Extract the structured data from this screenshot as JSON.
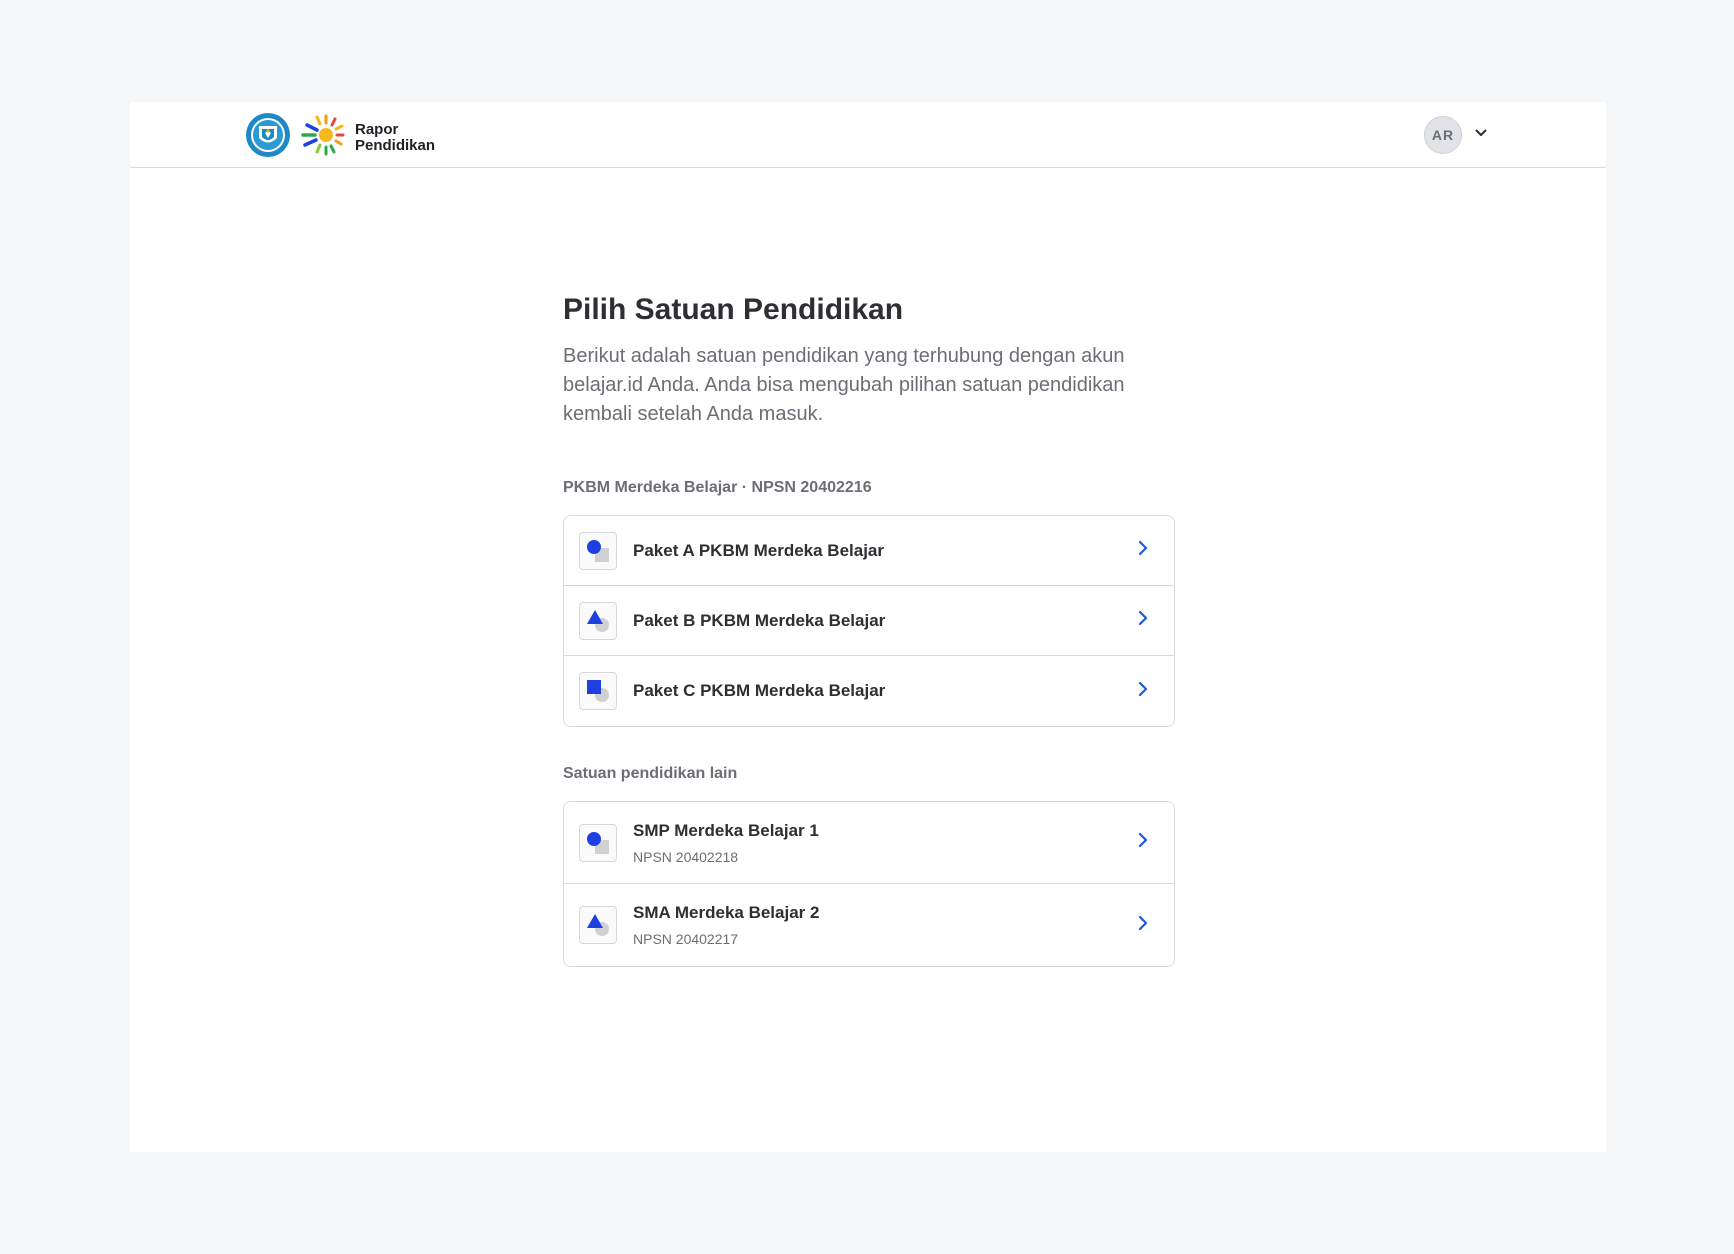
{
  "header": {
    "brand_line1": "Rapor",
    "brand_line2": "Pendidikan",
    "user_initials": "AR"
  },
  "main": {
    "title": "Pilih Satuan Pendidikan",
    "intro": "Berikut adalah satuan pendidikan yang terhubung dengan akun belajar.id Anda. Anda bisa mengubah pilihan satuan pendidikan kembali setelah Anda masuk."
  },
  "group_pkbm": {
    "label": "PKBM Merdeka Belajar · NPSN 20402216",
    "items": [
      {
        "title": "Paket A PKBM Merdeka Belajar",
        "icon": "circle-square-icon"
      },
      {
        "title": "Paket B PKBM Merdeka Belajar",
        "icon": "triangle-circle-icon"
      },
      {
        "title": "Paket C PKBM Merdeka Belajar",
        "icon": "square-circle-icon"
      }
    ]
  },
  "group_other": {
    "label": "Satuan pendidikan lain",
    "items": [
      {
        "title": "SMP Merdeka Belajar 1",
        "subtitle": "NPSN 20402218",
        "icon": "circle-square-icon"
      },
      {
        "title": "SMA Merdeka Belajar 2",
        "subtitle": "NPSN 20402217",
        "icon": "triangle-circle-icon"
      }
    ]
  },
  "colors": {
    "accent_blue": "#1a5ad9",
    "shape_blue": "#1e40e0",
    "shape_grey": "#cfd1d5",
    "border": "#d7d9dd",
    "background": "#f5f6f8"
  }
}
